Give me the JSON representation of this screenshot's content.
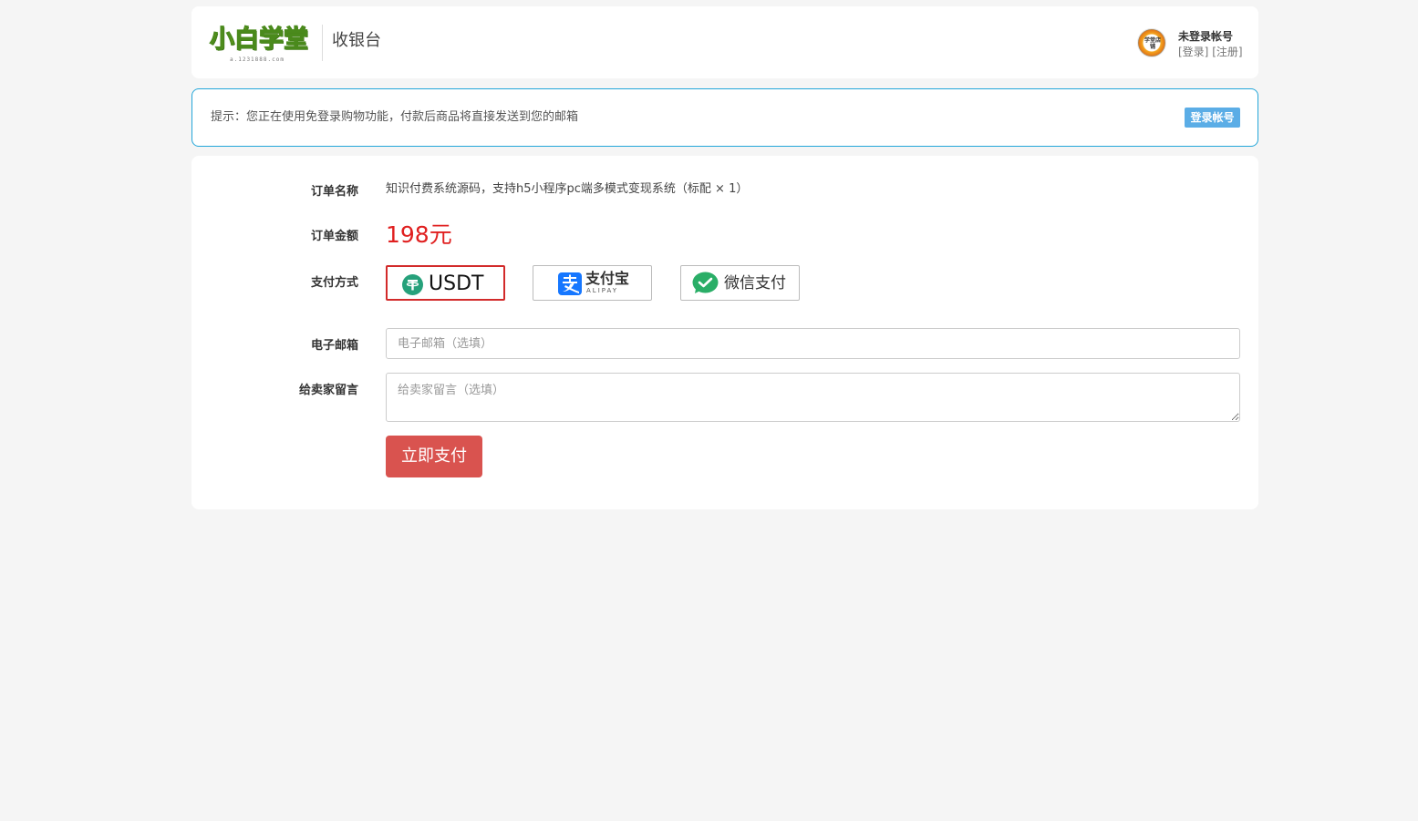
{
  "header": {
    "logo_text": "小白学堂",
    "logo_sub": "a.1231888.com",
    "title": "收银台",
    "user": {
      "name": "未登录帐号",
      "login_link": "[登录]",
      "register_link": "[注册]",
      "avatar_text": "学堂店铺"
    }
  },
  "notice": {
    "text": "提示：您正在使用免登录购物功能，付款后商品将直接发送到您的邮箱",
    "button": "登录帐号"
  },
  "order": {
    "name_label": "订单名称",
    "name_value": "知识付费系统源码，支持h5小程序pc端多模式变现系统（标配 × 1）",
    "amount_label": "订单金额",
    "amount_value": "198元",
    "payment_label": "支付方式",
    "payment_options": [
      {
        "label": "USDT",
        "icon": "usdt-icon",
        "selected": true
      },
      {
        "label": "支付宝",
        "sub": "ALIPAY",
        "icon": "alipay-icon",
        "selected": false
      },
      {
        "label": "微信支付",
        "icon": "wechat-icon",
        "selected": false
      }
    ],
    "email_label": "电子邮箱",
    "email_placeholder": "电子邮箱（选填）",
    "email_value": "",
    "message_label": "给卖家留言",
    "message_placeholder": "给卖家留言（选填）",
    "message_value": "",
    "submit": "立即支付"
  },
  "colors": {
    "background": "#f5f5f5",
    "notice_border": "#23a6d9",
    "notice_button": "#5bade6",
    "amount": "#e02020",
    "selected_border": "#d22a2a",
    "submit_button": "#d9534f",
    "usdt": "#26a17b",
    "alipay": "#1677ff",
    "wechat": "#2aae67"
  }
}
